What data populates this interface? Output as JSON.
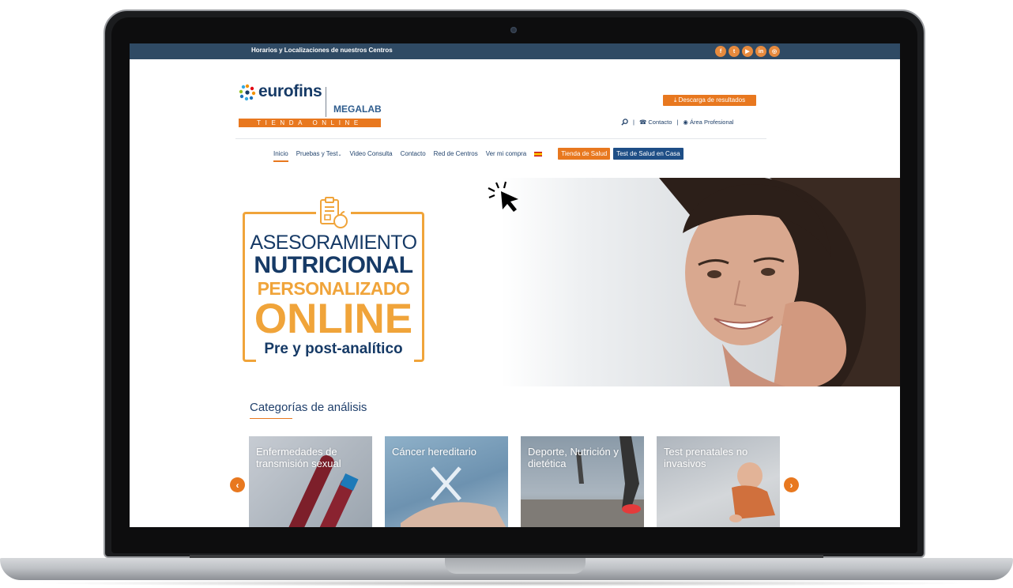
{
  "topbar": {
    "locations_text": "Horarios y Localizaciones de nuestros Centros",
    "social": [
      "f",
      "t",
      "▶",
      "in",
      "◎"
    ]
  },
  "header": {
    "logo_text": "eurofins",
    "brand_sub": "MEGALAB",
    "tienda_text": "TIENDA ONLINE",
    "download_label": "Descarga de resultados",
    "contact_label": "Contacto",
    "professional_label": "Área Profesional"
  },
  "nav": {
    "items": [
      "Inicio",
      "Pruebas y Test",
      "Video Consulta",
      "Contacto",
      "Red de Centros",
      "Ver mi compra"
    ],
    "tienda_salud": "Tienda de Salud",
    "test_casa": "Test de Salud en Casa"
  },
  "hero": {
    "line1": "ASESORAMIENTO",
    "line2": "NUTRICIONAL",
    "line3": "PERSONALIZADO",
    "line4": "ONLINE",
    "line5": "Pre y post-analítico"
  },
  "categories": {
    "title": "Categorías de análisis",
    "cards": [
      "Enfermedades de transmisión sexual",
      "Cáncer hereditario",
      "Deporte, Nutrición y dietética",
      "Test prenatales no invasivos"
    ]
  },
  "colors": {
    "navy": "#2f4a64",
    "orange": "#e8781f",
    "brand_blue": "#163a66",
    "gold": "#f0a43a"
  }
}
